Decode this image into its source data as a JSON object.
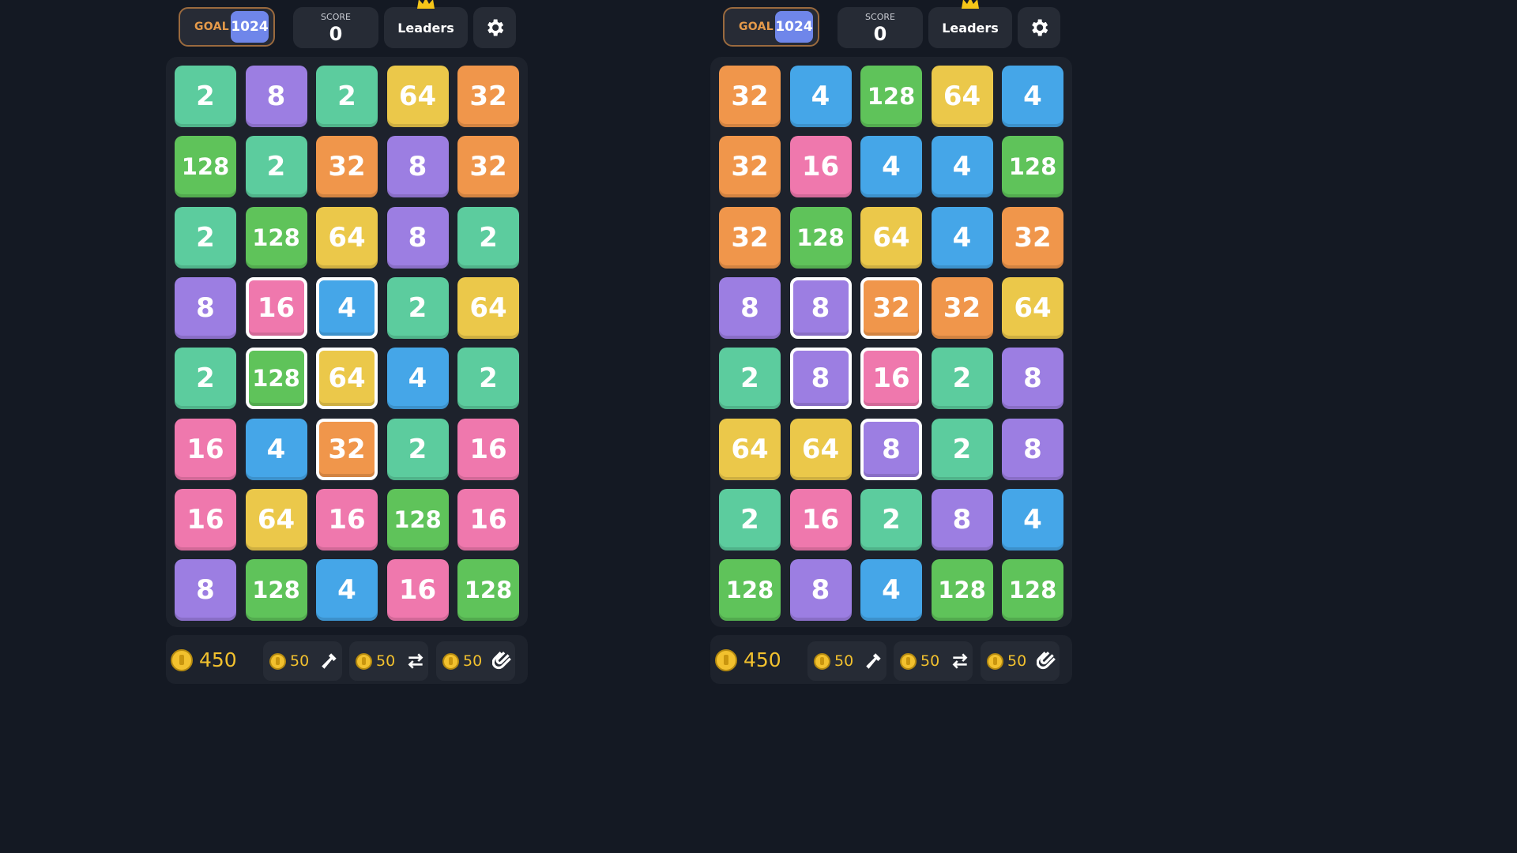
{
  "colors": {
    "2": "#5ccc9e",
    "4": "#45a6e8",
    "8": "#9c7ee2",
    "16": "#ef78ad",
    "32": "#f0964b",
    "64": "#ebc84a",
    "128": "#5fc35a"
  },
  "panels": [
    {
      "goal_label": "GOAL",
      "goal_value": "1024",
      "score_label": "SCORE",
      "score_value": "0",
      "leaders_label": "Leaders",
      "coins": "450",
      "boosters": [
        {
          "cost": "50",
          "icon": "hammer-icon"
        },
        {
          "cost": "50",
          "icon": "swap-icon"
        },
        {
          "cost": "50",
          "icon": "magnet-icon"
        }
      ],
      "grid": [
        [
          "2",
          "8",
          "2",
          "64",
          "32"
        ],
        [
          "128",
          "2",
          "32",
          "8",
          "32"
        ],
        [
          "2",
          "128",
          "64",
          "8",
          "2"
        ],
        [
          "8",
          "16",
          "4",
          "2",
          "64"
        ],
        [
          "2",
          "128",
          "64",
          "4",
          "2"
        ],
        [
          "16",
          "4",
          "32",
          "2",
          "16"
        ],
        [
          "16",
          "64",
          "16",
          "128",
          "16"
        ],
        [
          "8",
          "128",
          "4",
          "16",
          "128"
        ]
      ],
      "selected": [
        [
          3,
          1
        ],
        [
          3,
          2
        ],
        [
          4,
          1
        ],
        [
          4,
          2
        ],
        [
          5,
          2
        ]
      ]
    },
    {
      "goal_label": "GOAL",
      "goal_value": "1024",
      "score_label": "SCORE",
      "score_value": "0",
      "leaders_label": "Leaders",
      "coins": "450",
      "boosters": [
        {
          "cost": "50",
          "icon": "hammer-icon"
        },
        {
          "cost": "50",
          "icon": "swap-icon"
        },
        {
          "cost": "50",
          "icon": "magnet-icon"
        }
      ],
      "grid": [
        [
          "32",
          "4",
          "128",
          "64",
          "4"
        ],
        [
          "32",
          "16",
          "4",
          "4",
          "128"
        ],
        [
          "32",
          "128",
          "64",
          "4",
          "32"
        ],
        [
          "8",
          "8",
          "32",
          "32",
          "64"
        ],
        [
          "2",
          "8",
          "16",
          "2",
          "8"
        ],
        [
          "64",
          "64",
          "8",
          "2",
          "8"
        ],
        [
          "2",
          "16",
          "2",
          "8",
          "4"
        ],
        [
          "128",
          "8",
          "4",
          "128",
          "128"
        ]
      ],
      "selected": [
        [
          3,
          1
        ],
        [
          3,
          2
        ],
        [
          4,
          1
        ],
        [
          4,
          2
        ],
        [
          5,
          2
        ]
      ]
    }
  ]
}
